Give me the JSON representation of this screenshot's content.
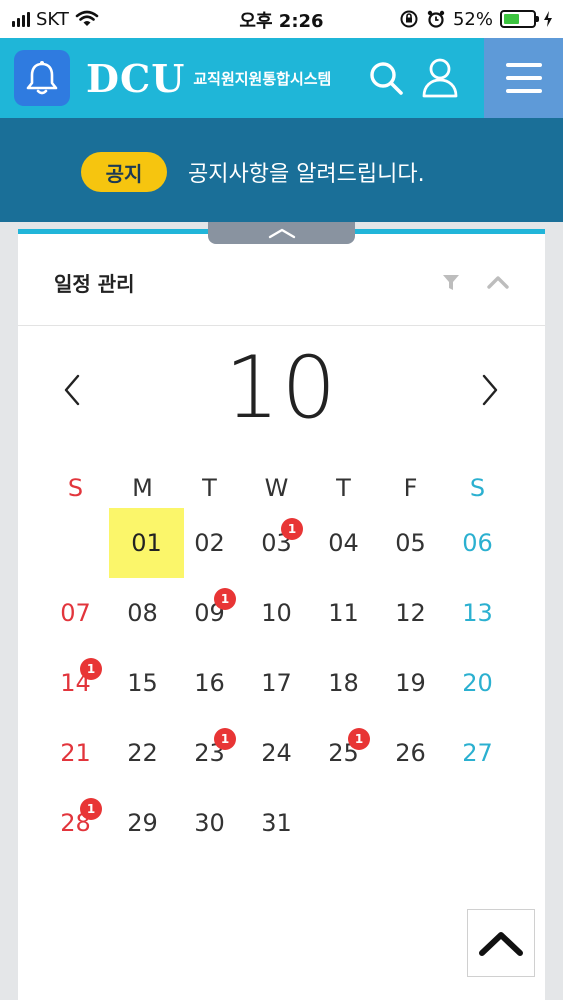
{
  "status_bar": {
    "carrier": "SKT",
    "time": "오후 2:26",
    "battery_percent": "52%",
    "battery_level": 0.52,
    "icons": [
      "signal-icon",
      "wifi-icon",
      "orientation-lock-icon",
      "alarm-icon",
      "battery-icon",
      "charging-icon"
    ]
  },
  "header": {
    "brand_logo": "DCU",
    "brand_subtitle": "교직원지원통합시스템",
    "icons": [
      "bell-icon",
      "search-icon",
      "user-icon",
      "menu-icon"
    ],
    "colors": {
      "header_bg": "#1fb6d8",
      "bell_box": "#2f7be0",
      "menu_box": "#5e9ad8"
    }
  },
  "notice": {
    "badge": "공지",
    "text": "공지사항을 알려드립니다.",
    "colors": {
      "bg": "#1a6f98",
      "badge_bg": "#f6c50f"
    }
  },
  "schedule": {
    "title": "일정 관리",
    "icons": [
      "filter-icon",
      "chevron-up-icon",
      "chevron-left-icon",
      "chevron-right-icon"
    ],
    "month": "10",
    "weekdays": [
      "S",
      "M",
      "T",
      "W",
      "T",
      "F",
      "S"
    ],
    "weeks": [
      [
        "",
        "01",
        "02",
        "03",
        "04",
        "05",
        "06"
      ],
      [
        "07",
        "08",
        "09",
        "10",
        "11",
        "12",
        "13"
      ],
      [
        "14",
        "15",
        "16",
        "17",
        "18",
        "19",
        "20"
      ],
      [
        "21",
        "22",
        "23",
        "24",
        "25",
        "26",
        "27"
      ],
      [
        "28",
        "29",
        "30",
        "31",
        "",
        "",
        ""
      ]
    ],
    "today": "01",
    "event_badges": [
      {
        "day": "03",
        "count": "1"
      },
      {
        "day": "09",
        "count": "1"
      },
      {
        "day": "14",
        "count": "1"
      },
      {
        "day": "23",
        "count": "1"
      },
      {
        "day": "25",
        "count": "1"
      },
      {
        "day": "28",
        "count": "1"
      }
    ],
    "colors": {
      "sunday": "#e2353c",
      "saturday": "#2bb0d0",
      "today_highlight": "#fbf66a",
      "badge": "#e83535",
      "accent": "#21b5d9"
    }
  },
  "scroll_top_icon": "chevron-up-icon"
}
